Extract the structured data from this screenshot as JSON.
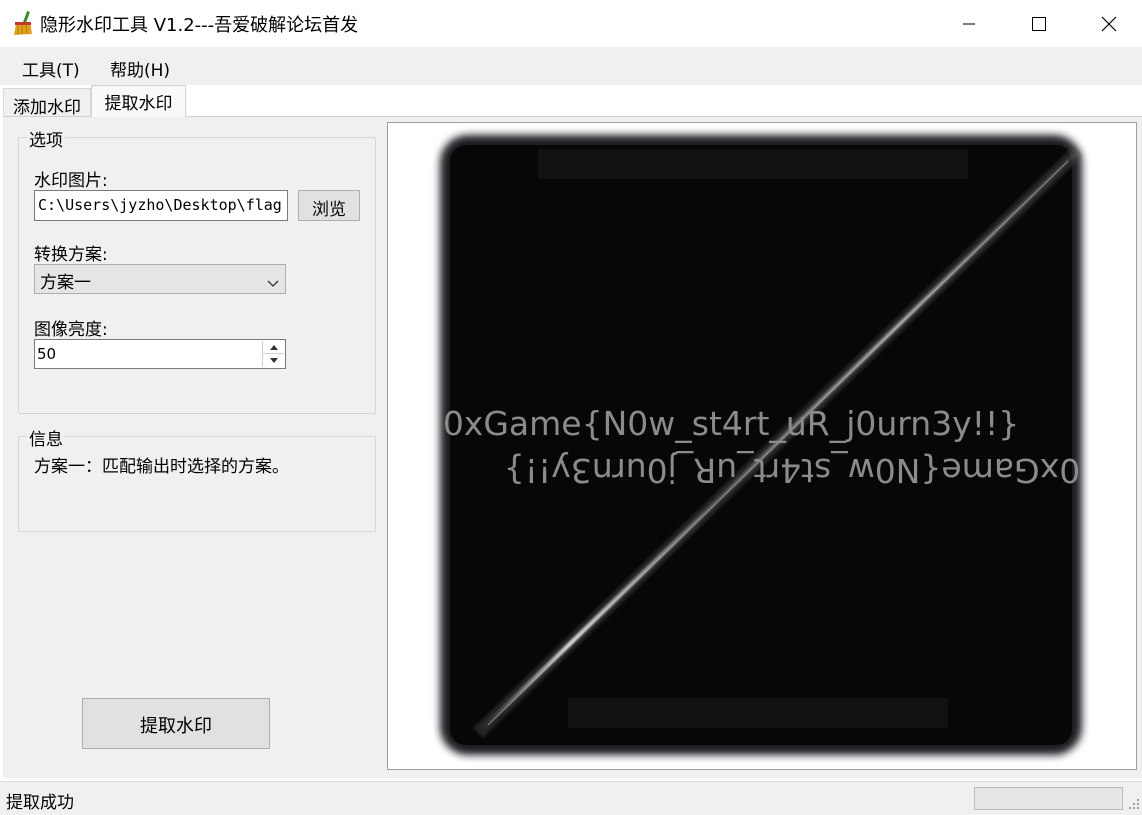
{
  "window": {
    "title": "隐形水印工具 V1.2---吾爱破解论坛首发",
    "icon": "broom-icon"
  },
  "menu": {
    "items": [
      "工具(T)",
      "帮助(H)"
    ]
  },
  "tabs": [
    {
      "label": "添加水印",
      "active": false
    },
    {
      "label": "提取水印",
      "active": true
    }
  ],
  "options": {
    "group_title": "选项",
    "watermark_image_label": "水印图片:",
    "watermark_image_path": "C:\\Users\\jyzho\\Desktop\\flag",
    "browse_label": "浏览",
    "scheme_label": "转换方案:",
    "scheme_selected": "方案一",
    "brightness_label": "图像亮度:",
    "brightness_value": "50"
  },
  "info": {
    "group_title": "信息",
    "text": "方案一：匹配输出时选择的方案。"
  },
  "extract_button_label": "提取水印",
  "preview": {
    "watermark_text": "0xGame{N0w_st4rt_uR_j0urn3y!!}",
    "watermark_text_mirrored": "0xGame{N0w_st4rt_uR_j0urn3y!!}",
    "text_color": "#8b8b8b",
    "background_color": "#000000"
  },
  "status": {
    "text": "提取成功",
    "progress_fraction": 0
  },
  "colors": {
    "chrome": "#f0f0f0",
    "button": "#e1e1e1",
    "progress_fill": "#06b025"
  }
}
